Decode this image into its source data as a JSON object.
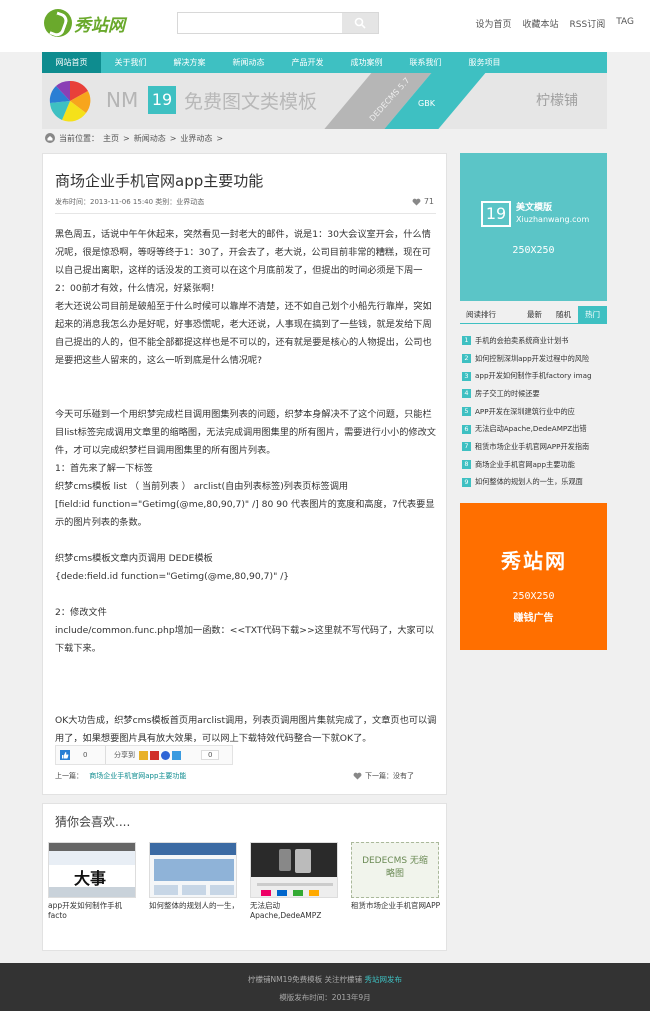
{
  "header": {
    "logo_text": "秀站网",
    "search": {
      "placeholder": "",
      "value": ""
    },
    "links": [
      "设为首页",
      "收藏本站",
      "RSS订阅",
      "TAG"
    ]
  },
  "nav": [
    "网站首页",
    "关于我们",
    "解决方案",
    "新闻动态",
    "产品开发",
    "成功案例",
    "联系我们",
    "服务项目"
  ],
  "banner": {
    "nm": "NM",
    "num": "19",
    "title": "免费图文类模板",
    "dedecms": "DEDECMS 5.7",
    "gbk": "GBK",
    "author": "柠檬铺"
  },
  "breadcrumb": {
    "prefix": "当前位置：",
    "items": [
      "主页",
      "新闻动态",
      "业界动态"
    ],
    "sep": ">"
  },
  "article": {
    "title": "商场企业手机官网app主要功能",
    "meta": "发布时间：2013-11-06 15:40 类别：业界动态",
    "likes": "71",
    "paragraphs": [
      "黑色周五，话说中午午休起来，突然看见一封老大的邮件，说是1：30大会议室开会，什么情况呢，很是惊恐啊，等呀等终于1：30了，开会去了，老大说，公司目前非常的糟糕，现在可以自己提出离职，这样的话没发的工资可以在这个月底前发了，但提出的时间必须是下周一2：00前才有效，什么情况，好紧张啊！",
      "老大还说公司目前是破船至于什么时候可以靠岸不清楚，还不如自己划个小船先行靠岸，突如起来的消息我怎么办是好呢，好事恐慌呢，老大还说，人事现在搞到了一些钱，就是发给下周自己提出的人的，但不能全部都提这样也是不可以的，还有就是要是核心的人物提出，公司也是要把这些人留来的，这么一听到底是什么情况呢?",
      "",
      "",
      "今天可乐碰到一个用织梦完成栏目调用图集列表的问题，织梦本身解决不了这个问题，只能栏目list标签完成调用文章里的缩略图，无法完成调用图集里的所有图片，需要进行小小的修改文件，才可以完成织梦栏目调用图集里的所有图片列表。",
      "1：首先来了解一下标签",
      "织梦cms模板 list （ 当前列表 ） arclist(自由列表标签)列表页标签调用",
      "[field:id function=\"Getimg(@me,80,90,7)\" /]    80 90 代表图片的宽度和高度，7代表要显示的图片列表的条数。",
      "",
      "织梦cms模板文章内页调用 DEDE模板",
      " {dede:field.id function=\"Getimg(@me,80,90,7)\" /}",
      "",
      "2：修改文件",
      "include/common.func.php增加一函数：<<TXT代码下载>>这里就不写代码了，大家可以下载下来。",
      "",
      "",
      "",
      "OK大功告成，织梦cms模板首页用arclist调用，列表页调用图片集就完成了，文章页也可以调用了，如果想要图片具有放大效果，可以网上下载特效代码整合一下就OK了。"
    ],
    "share": {
      "like_count": "0",
      "label": "分享到",
      "count": "0"
    },
    "prev_label": "上一篇：",
    "prev_link": "商场企业手机官网app主要功能",
    "next_label": "下一篇：没有了"
  },
  "related": {
    "title": "猜你会喜欢....",
    "items": [
      {
        "caption": "app开发如何制作手机facto",
        "img_text": "大事"
      },
      {
        "caption": "如何整体的规划人的一生，",
        "img_text": ""
      },
      {
        "caption": "无法启动Apache,DedeAMPZ",
        "img_text": ""
      },
      {
        "caption": "租赁市场企业手机官网APP",
        "img_text": "DEDECMS 无缩略图"
      }
    ]
  },
  "sidebar": {
    "ad1": {
      "num": "19",
      "title": "美文模版",
      "site": "Xiuzhanwang.com",
      "size": "250X250"
    },
    "tabs": {
      "label": "阅读排行",
      "items": [
        "最新",
        "随机",
        "热门"
      ],
      "active": 2
    },
    "list": [
      "手机的会拍卖系统商业计划书",
      "如何控制深圳app开发过程中的风险",
      "app开发如何制作手机factory imag",
      "房子交工的时候还要",
      "APP开发在深圳建筑行业中的应",
      "无法启动Apache,DedeAMPZ出错",
      "租赁市场企业手机官网APP开发指南",
      "商场企业手机官网app主要功能",
      "如何整体的规划人的一生，乐观面"
    ],
    "ad2": {
      "logo": "秀站网",
      "size": "250X250",
      "caption": "赚钱广告"
    }
  },
  "footer": {
    "line1_a": "柠檬铺NM19免费模板 关注柠檬铺 ",
    "line1_link": "秀站网发布",
    "line2": "模版发布时间：2013年9月"
  },
  "colors": {
    "accent": "#3ec0c2",
    "nav_active": "#0e8c8f",
    "orange": "#ff6f00",
    "logo_green": "#6aa92c"
  }
}
